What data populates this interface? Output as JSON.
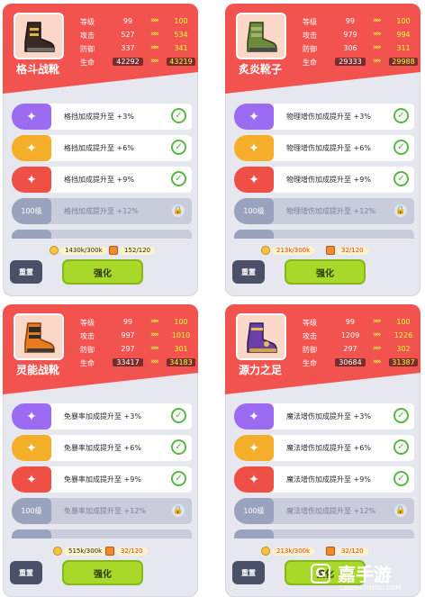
{
  "cards": [
    {
      "name": "格斗战靴",
      "boot_icon": "brown-boot-icon",
      "boot_color": "#3b2a24",
      "stats": [
        {
          "label": "等级",
          "current": "99",
          "next": "100"
        },
        {
          "label": "攻击",
          "current": "527",
          "next": "534"
        },
        {
          "label": "防御",
          "current": "337",
          "next": "341"
        },
        {
          "label": "生命",
          "current": "42292",
          "next": "43219"
        }
      ],
      "perks": [
        {
          "text": "格挡加成提升至 +3%"
        },
        {
          "text": "格挡加成提升至 +6%"
        },
        {
          "text": "格挡加成提升至 +9%"
        },
        {
          "level": "100级",
          "text": "格挡加成提升至 +12%"
        }
      ],
      "gold": "1430k/300k",
      "ore": "152/120",
      "reset_label": "重置",
      "upgrade_label": "强化"
    },
    {
      "name": "炙炎靴子",
      "boot_icon": "green-boot-icon",
      "boot_color": "#6b8a3a",
      "stats": [
        {
          "label": "等级",
          "current": "99",
          "next": "100"
        },
        {
          "label": "攻击",
          "current": "979",
          "next": "994"
        },
        {
          "label": "防御",
          "current": "306",
          "next": "311"
        },
        {
          "label": "生命",
          "current": "29333",
          "next": "29988"
        }
      ],
      "perks": [
        {
          "text": "物理增伤加成提升至 +3%"
        },
        {
          "text": "物理增伤加成提升至 +6%"
        },
        {
          "text": "物理增伤加成提升至 +9%"
        },
        {
          "level": "100级",
          "text": "物理增伤加成提升至 +12%"
        }
      ],
      "gold": "213k/300k",
      "ore": "32/120",
      "reset_label": "重置",
      "upgrade_label": "强化"
    },
    {
      "name": "灵能战靴",
      "boot_icon": "orange-boot-icon",
      "boot_color": "#e87a1e",
      "stats": [
        {
          "label": "等级",
          "current": "99",
          "next": "100"
        },
        {
          "label": "攻击",
          "current": "997",
          "next": "1010"
        },
        {
          "label": "防御",
          "current": "297",
          "next": "301"
        },
        {
          "label": "生命",
          "current": "33417",
          "next": "34183"
        }
      ],
      "perks": [
        {
          "text": "免暴率加成提升至 +3%"
        },
        {
          "text": "免暴率加成提升至 +6%"
        },
        {
          "text": "免暴率加成提升至 +9%"
        },
        {
          "level": "100级",
          "text": "免暴率加成提升至 +12%"
        }
      ],
      "gold": "515k/300k",
      "ore": "32/120",
      "reset_label": "重置",
      "upgrade_label": "强化"
    },
    {
      "name": "源力之足",
      "boot_icon": "purple-boot-icon",
      "boot_color": "#6a3fa6",
      "stats": [
        {
          "label": "等级",
          "current": "99",
          "next": "100"
        },
        {
          "label": "攻击",
          "current": "1209",
          "next": "1226"
        },
        {
          "label": "防御",
          "current": "297",
          "next": "302"
        },
        {
          "label": "生命",
          "current": "30684",
          "next": "31387"
        }
      ],
      "perks": [
        {
          "text": "魔法增伤加成提升至 +3%"
        },
        {
          "text": "魔法增伤加成提升至 +6%"
        },
        {
          "text": "魔法增伤加成提升至 +9%"
        },
        {
          "level": "100级",
          "text": "魔法增伤加成提升至 +12%"
        }
      ],
      "gold": "213k/300k",
      "ore": "32/120",
      "reset_label": "重置",
      "upgrade_label": "强化"
    }
  ],
  "perk_colors": [
    "#9b6cf2",
    "#f5ae2a",
    "#ef5046"
  ],
  "watermark": {
    "logo": "G",
    "text": "嘉手游",
    "url": "CAOSHOUYOU.COM"
  }
}
